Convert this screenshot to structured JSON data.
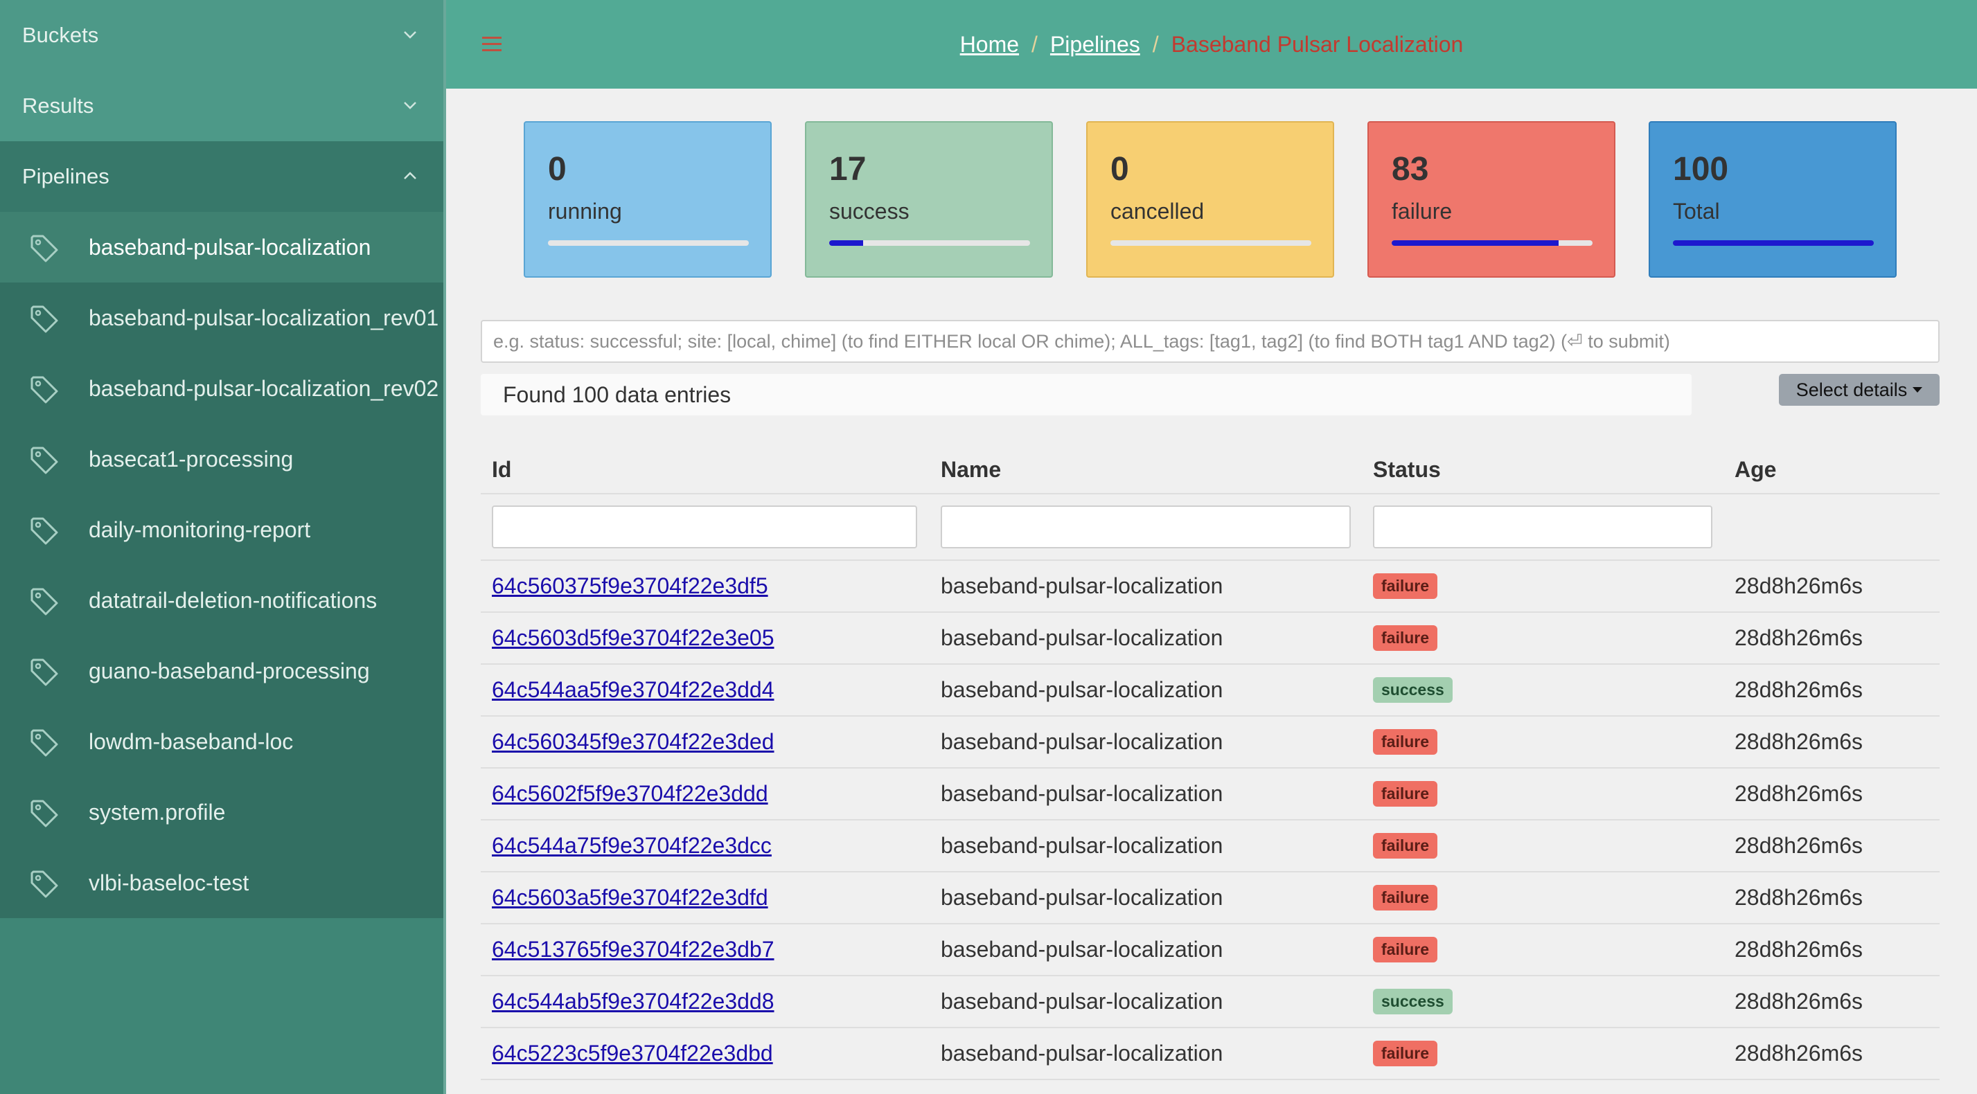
{
  "sidebar": {
    "sections": {
      "buckets": "Buckets",
      "results": "Results",
      "pipelines": "Pipelines"
    },
    "items": [
      {
        "label": "baseband-pulsar-localization",
        "active": true
      },
      {
        "label": "baseband-pulsar-localization_rev01"
      },
      {
        "label": "baseband-pulsar-localization_rev02"
      },
      {
        "label": "basecat1-processing"
      },
      {
        "label": "daily-monitoring-report"
      },
      {
        "label": "datatrail-deletion-notifications"
      },
      {
        "label": "guano-baseband-processing"
      },
      {
        "label": "lowdm-baseband-loc"
      },
      {
        "label": "system.profile"
      },
      {
        "label": "vlbi-baseloc-test"
      }
    ]
  },
  "header": {
    "breadcrumb": {
      "home": "Home",
      "pipelines": "Pipelines",
      "current": "Baseband Pulsar Localization",
      "separator": "/"
    }
  },
  "stats": {
    "running": {
      "count": "0",
      "label": "running",
      "fraction": 0.0
    },
    "success": {
      "count": "17",
      "label": "success",
      "fraction": 0.17
    },
    "cancelled": {
      "count": "0",
      "label": "cancelled",
      "fraction": 0.0
    },
    "failure": {
      "count": "83",
      "label": "failure",
      "fraction": 0.83
    },
    "total": {
      "count": "100",
      "label": "Total",
      "fraction": 1.0
    }
  },
  "search": {
    "placeholder": "e.g. status: successful; site: [local, chime] (to find EITHER local OR chime); ALL_tags: [tag1, tag2] (to find BOTH tag1 AND tag2) (⏎ to submit)"
  },
  "results": {
    "found_text": "Found 100 data entries",
    "select_details": "Select details"
  },
  "table": {
    "columns": [
      "Id",
      "Name",
      "Status",
      "Age"
    ],
    "rows": [
      {
        "id": "64c560375f9e3704f22e3df5",
        "name": "baseband-pulsar-localization",
        "status": "failure",
        "age": "28d8h26m6s"
      },
      {
        "id": "64c5603d5f9e3704f22e3e05",
        "name": "baseband-pulsar-localization",
        "status": "failure",
        "age": "28d8h26m6s"
      },
      {
        "id": "64c544aa5f9e3704f22e3dd4",
        "name": "baseband-pulsar-localization",
        "status": "success",
        "age": "28d8h26m6s"
      },
      {
        "id": "64c560345f9e3704f22e3ded",
        "name": "baseband-pulsar-localization",
        "status": "failure",
        "age": "28d8h26m6s"
      },
      {
        "id": "64c5602f5f9e3704f22e3ddd",
        "name": "baseband-pulsar-localization",
        "status": "failure",
        "age": "28d8h26m6s"
      },
      {
        "id": "64c544a75f9e3704f22e3dcc",
        "name": "baseband-pulsar-localization",
        "status": "failure",
        "age": "28d8h26m6s"
      },
      {
        "id": "64c5603a5f9e3704f22e3dfd",
        "name": "baseband-pulsar-localization",
        "status": "failure",
        "age": "28d8h26m6s"
      },
      {
        "id": "64c513765f9e3704f22e3db7",
        "name": "baseband-pulsar-localization",
        "status": "failure",
        "age": "28d8h26m6s"
      },
      {
        "id": "64c544ab5f9e3704f22e3dd8",
        "name": "baseband-pulsar-localization",
        "status": "success",
        "age": "28d8h26m6s"
      },
      {
        "id": "64c5223c5f9e3704f22e3dbd",
        "name": "baseband-pulsar-localization",
        "status": "failure",
        "age": "28d8h26m6s"
      }
    ]
  },
  "colors": {
    "sidebar_bg": "#336f62",
    "topbar_bg": "#52aa95",
    "running": "#86c4ea",
    "success": "#a5cfb5",
    "cancelled": "#f7cf72",
    "failure": "#ef776c",
    "total": "#4898d3",
    "progress": "#1d18ce"
  },
  "icons": {
    "menu": "hamburger-icon",
    "collapse": "chevron-icon",
    "pipeline": "tag-icon"
  }
}
